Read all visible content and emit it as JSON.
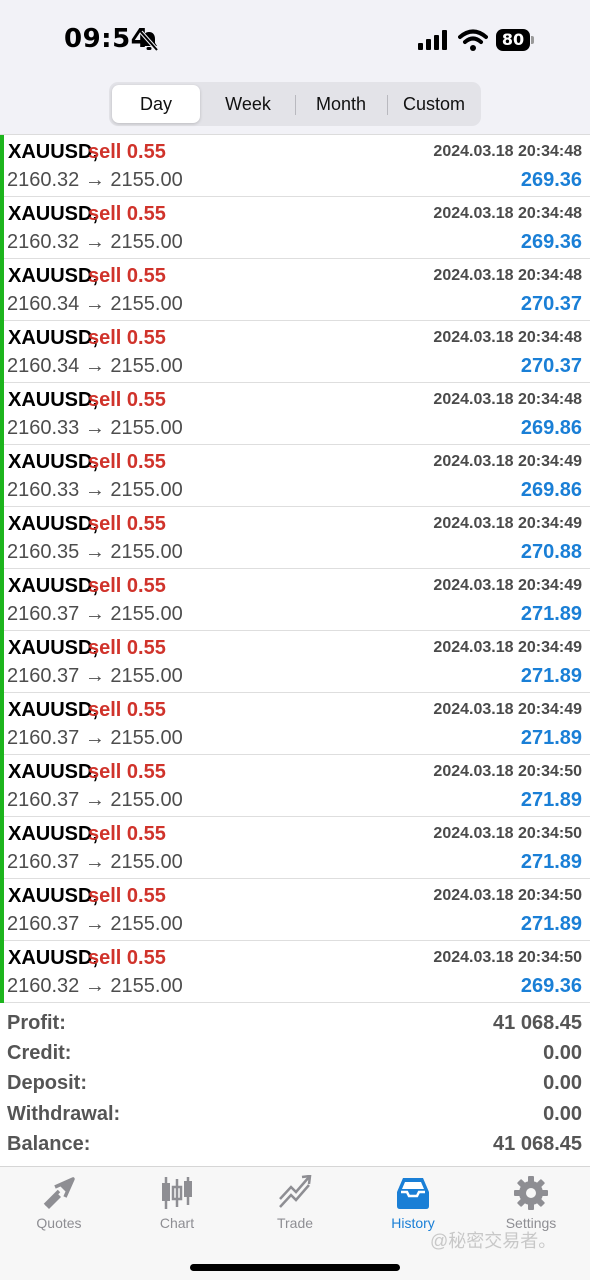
{
  "status_bar": {
    "time": "09:54",
    "battery": "80"
  },
  "period_tabs": [
    {
      "label": "Day",
      "active": true
    },
    {
      "label": "Week",
      "active": false
    },
    {
      "label": "Month",
      "active": false
    },
    {
      "label": "Custom",
      "active": false
    }
  ],
  "deals": [
    {
      "symbol": "XAUUSD,",
      "action": "sell 0.55",
      "prices": "2160.32 → 2155.00",
      "time": "2024.03.18 20:34:48",
      "profit": "269.36"
    },
    {
      "symbol": "XAUUSD,",
      "action": "sell 0.55",
      "prices": "2160.32 → 2155.00",
      "time": "2024.03.18 20:34:48",
      "profit": "269.36"
    },
    {
      "symbol": "XAUUSD,",
      "action": "sell 0.55",
      "prices": "2160.34 → 2155.00",
      "time": "2024.03.18 20:34:48",
      "profit": "270.37"
    },
    {
      "symbol": "XAUUSD,",
      "action": "sell 0.55",
      "prices": "2160.34 → 2155.00",
      "time": "2024.03.18 20:34:48",
      "profit": "270.37"
    },
    {
      "symbol": "XAUUSD,",
      "action": "sell 0.55",
      "prices": "2160.33 → 2155.00",
      "time": "2024.03.18 20:34:48",
      "profit": "269.86"
    },
    {
      "symbol": "XAUUSD,",
      "action": "sell 0.55",
      "prices": "2160.33 → 2155.00",
      "time": "2024.03.18 20:34:49",
      "profit": "269.86"
    },
    {
      "symbol": "XAUUSD,",
      "action": "sell 0.55",
      "prices": "2160.35 → 2155.00",
      "time": "2024.03.18 20:34:49",
      "profit": "270.88"
    },
    {
      "symbol": "XAUUSD,",
      "action": "sell 0.55",
      "prices": "2160.37 → 2155.00",
      "time": "2024.03.18 20:34:49",
      "profit": "271.89"
    },
    {
      "symbol": "XAUUSD,",
      "action": "sell 0.55",
      "prices": "2160.37 → 2155.00",
      "time": "2024.03.18 20:34:49",
      "profit": "271.89"
    },
    {
      "symbol": "XAUUSD,",
      "action": "sell 0.55",
      "prices": "2160.37 → 2155.00",
      "time": "2024.03.18 20:34:49",
      "profit": "271.89"
    },
    {
      "symbol": "XAUUSD,",
      "action": "sell 0.55",
      "prices": "2160.37 → 2155.00",
      "time": "2024.03.18 20:34:50",
      "profit": "271.89"
    },
    {
      "symbol": "XAUUSD,",
      "action": "sell 0.55",
      "prices": "2160.37 → 2155.00",
      "time": "2024.03.18 20:34:50",
      "profit": "271.89"
    },
    {
      "symbol": "XAUUSD,",
      "action": "sell 0.55",
      "prices": "2160.37 → 2155.00",
      "time": "2024.03.18 20:34:50",
      "profit": "271.89"
    },
    {
      "symbol": "XAUUSD,",
      "action": "sell 0.55",
      "prices": "2160.32 → 2155.00",
      "time": "2024.03.18 20:34:50",
      "profit": "269.36"
    }
  ],
  "summary": [
    {
      "label": "Profit:",
      "value": "41 068.45"
    },
    {
      "label": "Credit:",
      "value": "0.00"
    },
    {
      "label": "Deposit:",
      "value": "0.00"
    },
    {
      "label": "Withdrawal:",
      "value": "0.00"
    },
    {
      "label": "Balance:",
      "value": "41 068.45"
    }
  ],
  "tab_bar": [
    {
      "label": "Quotes",
      "icon": "quotes-icon",
      "active": false
    },
    {
      "label": "Chart",
      "icon": "chart-icon",
      "active": false
    },
    {
      "label": "Trade",
      "icon": "trade-icon",
      "active": false
    },
    {
      "label": "History",
      "icon": "history-icon",
      "active": true
    },
    {
      "label": "Settings",
      "icon": "settings-icon",
      "active": false
    }
  ],
  "watermark": "@秘密交易者。",
  "colors": {
    "sell": "#d0332b",
    "profit": "#1a7fd6",
    "deal_bar": "#1db51d",
    "active_tab": "#1a7fd6",
    "inactive_tab": "#8e8e93"
  }
}
